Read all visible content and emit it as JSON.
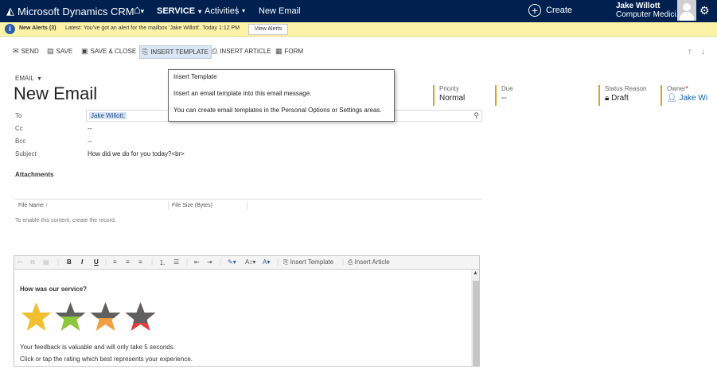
{
  "nav": {
    "brand": "Microsoft Dynamics CRM",
    "service": "SERVICE",
    "activities": "Activities",
    "separator": "|",
    "breadcrumb": "New Email",
    "create": "Create",
    "user_name": "Jake Willott",
    "user_org": "Computer Medici..."
  },
  "alert": {
    "count": "New Alerts (3)",
    "message": "Latest: You've got an alert for the mailbox 'Jake Willott'. Today 1:12 PM",
    "view_button": "View Alerts"
  },
  "commands": {
    "send": "SEND",
    "save": "SAVE",
    "save_close": "SAVE & CLOSE",
    "insert_template": "INSERT TEMPLATE",
    "insert_article": "INSERT ARTICLE",
    "form": "FORM"
  },
  "form": {
    "entity": "EMAIL",
    "title": "New Email"
  },
  "header_fields": {
    "priority_label": "Priority",
    "priority_value": "Normal",
    "due_label": "Due",
    "due_value": "--",
    "status_label": "Status Reason",
    "status_value": "Draft",
    "owner_label": "Owner",
    "owner_required": "*",
    "owner_value": "Jake Wi"
  },
  "tooltip": {
    "title": "Insert Template",
    "line1": "Insert an email template into this email message.",
    "line2": "You can create email templates in the Personal Options or Settings areas."
  },
  "fields": {
    "to_label": "To",
    "to_value": "Jake Willott;",
    "cc_label": "Cc",
    "cc_value": "--",
    "bcc_label": "Bcc",
    "bcc_value": "--",
    "subject_label": "Subject",
    "subject_value": "How did we do for you today?<br>"
  },
  "attachments": {
    "title": "Attachments",
    "col_file_name": "File Name ↑",
    "col_file_size": "File Size (Bytes)",
    "empty_message": "To enable this content, create the record."
  },
  "editor_toolbar": {
    "bold": "B",
    "italic": "I",
    "underline": "U",
    "insert_template": "Insert Template",
    "insert_article": "Insert Article"
  },
  "editor_body": {
    "question": "How was our service?",
    "feedback_line1": "Your feedback is valuable and will only take 5 seconds.",
    "feedback_line2": "Click or tap the rating which best represents your experience."
  },
  "colors": {
    "nav_bg": "#002050",
    "alert_bg": "#fdf3a8",
    "header_accent": "#e0a020",
    "link": "#1160b7",
    "star_yellow": "#f0c030",
    "star_green": "#8cc63f",
    "star_orange": "#f0a040",
    "star_red": "#e04040",
    "star_gray": "#606060"
  }
}
